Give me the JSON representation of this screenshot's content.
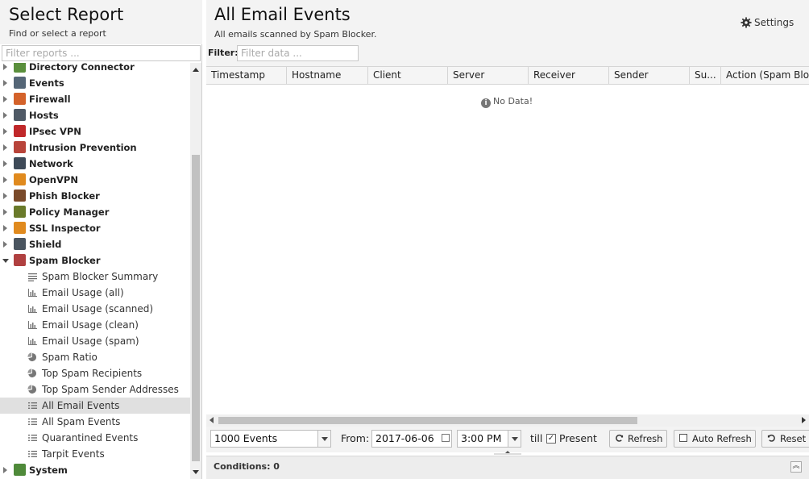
{
  "left": {
    "title": "Select Report",
    "subtitle": "Find or select a report",
    "filter_placeholder": "Filter reports ..."
  },
  "tree": {
    "categories": [
      {
        "label": "Directory Connector",
        "icon": "directory-connector-icon",
        "color": "#5a8f3c"
      },
      {
        "label": "Events",
        "icon": "events-icon",
        "color": "#556677"
      },
      {
        "label": "Firewall",
        "icon": "firewall-icon",
        "color": "#d4622a"
      },
      {
        "label": "Hosts",
        "icon": "hosts-icon",
        "color": "#505a66"
      },
      {
        "label": "IPsec VPN",
        "icon": "ipsec-vpn-icon",
        "color": "#c0282a"
      },
      {
        "label": "Intrusion Prevention",
        "icon": "intrusion-prevention-icon",
        "color": "#b8443a"
      },
      {
        "label": "Network",
        "icon": "network-icon",
        "color": "#3e4a58"
      },
      {
        "label": "OpenVPN",
        "icon": "openvpn-icon",
        "color": "#e08a1e"
      },
      {
        "label": "Phish Blocker",
        "icon": "phish-blocker-icon",
        "color": "#7a4a2a"
      },
      {
        "label": "Policy Manager",
        "icon": "policy-manager-icon",
        "color": "#6a7a2a"
      },
      {
        "label": "SSL Inspector",
        "icon": "ssl-inspector-icon",
        "color": "#e08a1e"
      },
      {
        "label": "Shield",
        "icon": "shield-icon",
        "color": "#4a5560"
      },
      {
        "label": "Spam Blocker",
        "icon": "spam-blocker-icon",
        "color": "#b04040"
      }
    ],
    "spam_items": [
      {
        "label": "Spam Blocker Summary",
        "icon": "text-lines-icon"
      },
      {
        "label": "Email Usage (all)",
        "icon": "bar-chart-icon"
      },
      {
        "label": "Email Usage (scanned)",
        "icon": "bar-chart-icon"
      },
      {
        "label": "Email Usage (clean)",
        "icon": "bar-chart-icon"
      },
      {
        "label": "Email Usage (spam)",
        "icon": "bar-chart-icon"
      },
      {
        "label": "Spam Ratio",
        "icon": "pie-chart-icon"
      },
      {
        "label": "Top Spam Recipients",
        "icon": "pie-chart-icon"
      },
      {
        "label": "Top Spam Sender Addresses",
        "icon": "pie-chart-icon"
      },
      {
        "label": "All Email Events",
        "icon": "list-icon"
      },
      {
        "label": "All Spam Events",
        "icon": "list-icon"
      },
      {
        "label": "Quarantined Events",
        "icon": "list-icon"
      },
      {
        "label": "Tarpit Events",
        "icon": "list-icon"
      }
    ],
    "after": {
      "label": "System",
      "icon": "system-icon",
      "color": "#4f8a3a"
    }
  },
  "main": {
    "title": "All Email Events",
    "subtitle": "All emails scanned by Spam Blocker.",
    "settings_label": "Settings",
    "filter_label": "Filter:",
    "filter_placeholder": "Filter data ...",
    "columns": [
      "Timestamp",
      "Hostname",
      "Client",
      "Server",
      "Receiver",
      "Sender",
      "Su...",
      "Action (Spam Blo..."
    ],
    "no_data": "No Data!"
  },
  "toolbar": {
    "events_select": "1000 Events",
    "from_label": "From:",
    "from_date": "2017-06-06",
    "from_time": "3:00 PM",
    "till_label": "till",
    "present_label": "Present",
    "present_checked": "✓",
    "refresh_label": "Refresh",
    "auto_refresh_label": "Auto Refresh",
    "reset_label": "Reset"
  },
  "conditions": {
    "label": "Conditions: 0",
    "collapse_glyph": "︽"
  },
  "colors": {
    "header_bg": "#f3f3f3",
    "selected_row": "#e0e0e0"
  }
}
